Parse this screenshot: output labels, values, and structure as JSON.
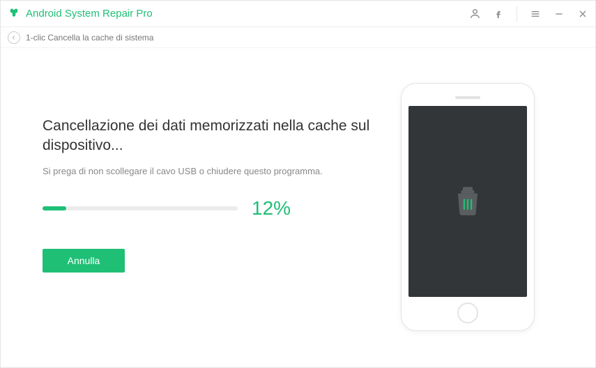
{
  "app": {
    "title": "Android System Repair Pro"
  },
  "breadcrumb": {
    "label": "1-clic Cancella la cache di sistema"
  },
  "main": {
    "heading": "Cancellazione dei dati memorizzati nella cache sul dispositivo...",
    "subtext": "Si prega di non scollegare il cavo USB o chiudere questo programma.",
    "progress_percent": 12,
    "progress_label": "12%",
    "cancel_label": "Annulla"
  },
  "colors": {
    "accent": "#1fbf76"
  }
}
